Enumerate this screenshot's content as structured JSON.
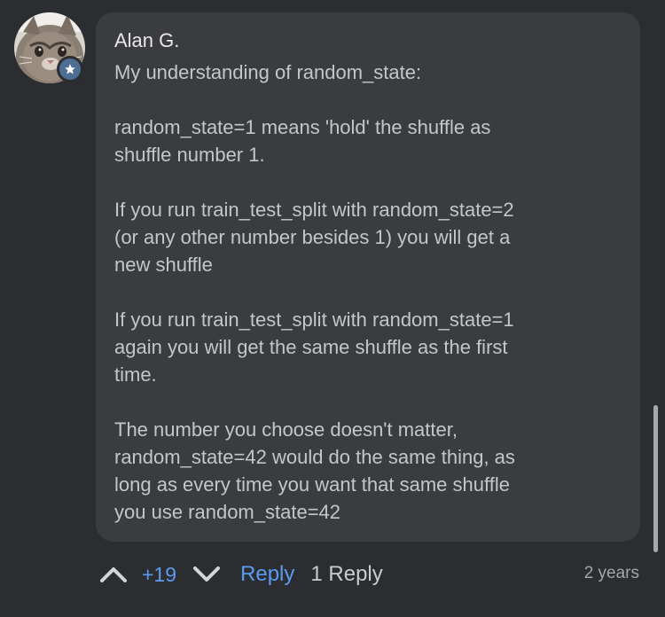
{
  "comment": {
    "author": "Alan G.",
    "paragraphs": [
      "My understanding of random_state:",
      "random_state=1 means 'hold' the shuffle as\nshuffle number 1.",
      "If you run train_test_split with random_state=2\n(or any other number besides 1) you will get a\nnew shuffle",
      "If you run train_test_split with random_state=1\nagain you will get the same shuffle as the first\ntime.",
      "The number you choose doesn't matter,\nrandom_state=42 would do the same thing, as\nlong as every time you want that same shuffle\nyou use random_state=42"
    ]
  },
  "actions": {
    "upvote_icon": "chevron-up-icon",
    "vote_count": "+19",
    "downvote_icon": "chevron-down-icon",
    "reply_label": "Reply",
    "replies_label": "1 Reply",
    "timestamp": "2 years"
  },
  "badge_icon": "star-icon",
  "colors": {
    "background": "#2b2d30",
    "bubble": "#3a3c40",
    "accent": "#5b9bef",
    "badge": "#4d6d93"
  }
}
